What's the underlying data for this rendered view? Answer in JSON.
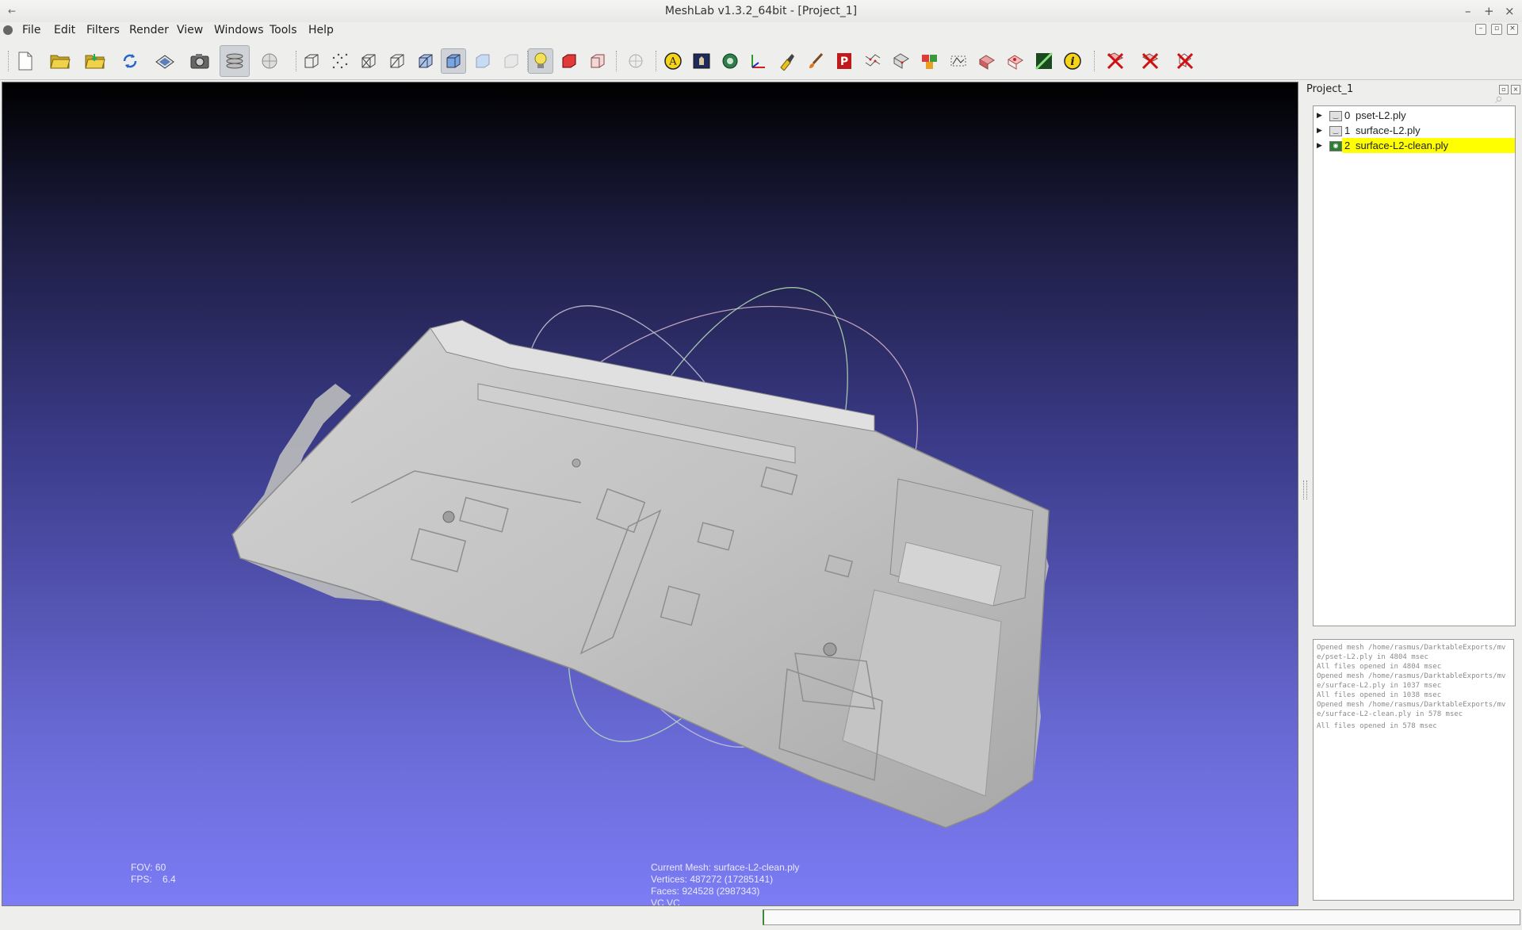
{
  "window": {
    "title": "MeshLab v1.3.2_64bit - [Project_1]",
    "left_glyph": "←",
    "controls": [
      "–",
      "+",
      "×"
    ]
  },
  "menubar": {
    "items": [
      "File",
      "Edit",
      "Filters",
      "Render",
      "View",
      "Windows",
      "Tools",
      "Help"
    ]
  },
  "toolbar": {
    "icons": [
      "new-project-icon",
      "open-project-icon",
      "import-mesh-icon",
      "reload-icon",
      "save-mesh-icon",
      "snapshot-icon",
      "layers-icon",
      "plugin-icon",
      "bounding-box-icon",
      "points-icon",
      "wireframe-icon",
      "hidden-lines-icon",
      "flat-lines-icon",
      "flat-shading-icon",
      "smooth-shading-icon",
      "texture-icon",
      "light-on-icon",
      "double-side-light-icon",
      "back-face-culling-icon",
      "manipulator-icon",
      "annotation-icon",
      "raster-icon",
      "georef-icon",
      "axes-icon",
      "paint-icon",
      "brush-icon",
      "point-picker-icon",
      "align-icon",
      "measure-icon",
      "select-faces-icon",
      "select-vertices-icon",
      "select-connected-icon",
      "pick-points-icon",
      "quality-icon",
      "info-icon",
      "delete-faces-icon",
      "delete-vertices-icon",
      "delete-all-icon"
    ]
  },
  "viewport": {
    "fov_label": "FOV: 60",
    "fps_label": "FPS:",
    "fps_value": "6.4",
    "current_mesh": "Current Mesh: surface-L2-clean.ply",
    "vertices": "Vertices: 487272 (17285141)",
    "faces": "Faces: 924528 (2987343)",
    "vc": "VC VC"
  },
  "dock": {
    "title": "Project_1",
    "layers": [
      {
        "index": "0",
        "name": "pset-L2.ply",
        "selected": false
      },
      {
        "index": "1",
        "name": "surface-L2.ply",
        "selected": false
      },
      {
        "index": "2",
        "name": "surface-L2-clean.ply",
        "selected": true
      }
    ],
    "log": [
      "Opened mesh /home/rasmus/DarktableExports/mve/pset-L2.ply in 4804 msec",
      "All files opened in 4804 msec",
      "Opened mesh /home/rasmus/DarktableExports/mve/surface-L2.ply in 1037 msec",
      "All files opened in 1038 msec",
      "Opened mesh /home/rasmus/DarktableExports/mve/surface-L2-clean.ply in 578 msec",
      "All files opened in 578 msec"
    ]
  }
}
